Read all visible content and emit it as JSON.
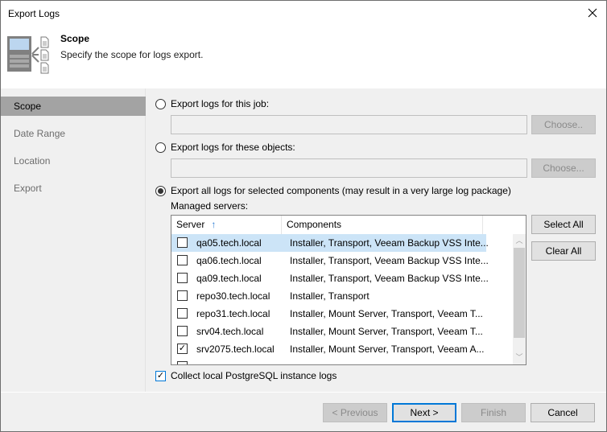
{
  "window": {
    "title": "Export Logs"
  },
  "header": {
    "title": "Scope",
    "subtitle": "Specify the scope for logs export.",
    "icon": "server-logs-icon"
  },
  "sidebar": {
    "items": [
      {
        "label": "Scope",
        "active": true
      },
      {
        "label": "Date Range",
        "active": false
      },
      {
        "label": "Location",
        "active": false
      },
      {
        "label": "Export",
        "active": false
      }
    ]
  },
  "scope": {
    "option_job": {
      "label": "Export logs for this job:",
      "selected": false,
      "value": "",
      "choose_label": "Choose.."
    },
    "option_objects": {
      "label": "Export logs for these objects:",
      "selected": false,
      "value": "",
      "choose_label": "Choose..."
    },
    "option_components": {
      "label": "Export all logs for selected components (may result in a very large log package)",
      "selected": true
    },
    "managed_servers_label": "Managed servers:",
    "select_all_label": "Select All",
    "clear_all_label": "Clear All",
    "grid": {
      "columns": [
        {
          "label": "Server",
          "sort": "ascending",
          "sort_icon": "↑"
        },
        {
          "label": "Components"
        }
      ],
      "rows": [
        {
          "server": "qa05.tech.local",
          "components": "Installer, Transport, Veeam Backup VSS Inte...",
          "checked": false,
          "selected": true
        },
        {
          "server": "qa06.tech.local",
          "components": "Installer, Transport, Veeam Backup VSS Inte...",
          "checked": false,
          "selected": false
        },
        {
          "server": "qa09.tech.local",
          "components": "Installer, Transport, Veeam Backup VSS Inte...",
          "checked": false,
          "selected": false
        },
        {
          "server": "repo30.tech.local",
          "components": "Installer, Transport",
          "checked": false,
          "selected": false
        },
        {
          "server": "repo31.tech.local",
          "components": "Installer, Mount Server, Transport, Veeam T...",
          "checked": false,
          "selected": false
        },
        {
          "server": "srv04.tech.local",
          "components": "Installer, Mount Server, Transport, Veeam T...",
          "checked": false,
          "selected": false
        },
        {
          "server": "srv2075.tech.local",
          "components": "Installer, Mount Server, Transport, Veeam A...",
          "checked": true,
          "selected": false
        }
      ]
    },
    "collect_postgres": {
      "label": "Collect local PostgreSQL instance logs",
      "checked": true
    }
  },
  "footer": {
    "previous_label": "< Previous",
    "next_label": "Next >",
    "finish_label": "Finish",
    "cancel_label": "Cancel"
  },
  "colors": {
    "accent": "#0078d7",
    "selection": "#cce4f7",
    "sidebar_active": "#a3a3a3"
  }
}
